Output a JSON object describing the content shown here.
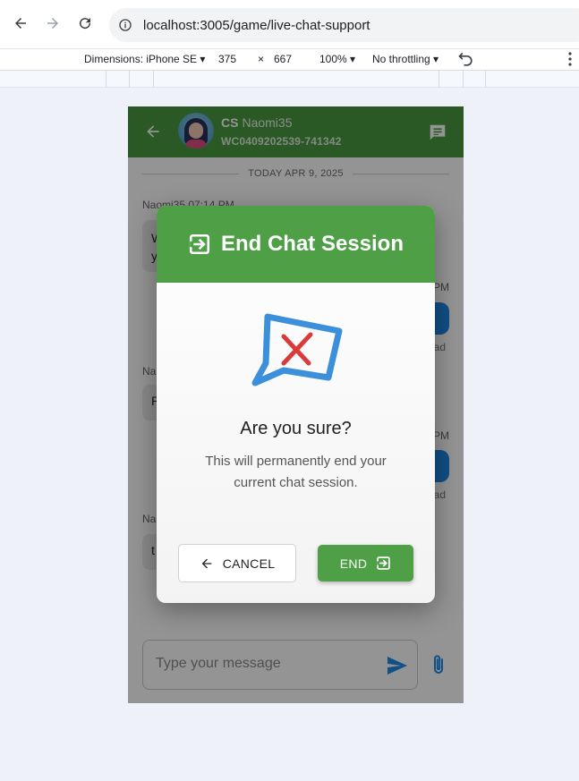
{
  "browser": {
    "url": "localhost:3005/game/live-chat-support"
  },
  "devtools": {
    "dimensions_label": "Dimensions: iPhone SE",
    "width": "375",
    "times": "×",
    "height": "667",
    "zoom": "100%",
    "throttling": "No throttling"
  },
  "chat": {
    "agent_prefix": "CS",
    "agent_name": "Naomi35",
    "ticket_id": "WC0409202539-741342",
    "date_divider": "TODAY APR 9, 2025",
    "messages": [
      {
        "meta": "Naomi35 07:14 PM",
        "partial": "W\ny"
      },
      {
        "time": "PM",
        "partial": "i",
        "read": "ad"
      },
      {
        "meta": "Na",
        "partial": "P"
      },
      {
        "time": "PM",
        "partial": "n",
        "read": "ad"
      },
      {
        "meta": "Na",
        "partial": "t"
      }
    ],
    "input_placeholder": "Type your message"
  },
  "dialog": {
    "title": "End Chat Session",
    "question": "Are you sure?",
    "description": "This will permanently end your current chat session.",
    "cancel_label": "CANCEL",
    "end_label": "END"
  },
  "colors": {
    "header_green": "#4a9a43",
    "end_button": "#4f9f47",
    "bubble_blue": "#1e88e5",
    "hero_icon_blue": "#3b8fdb",
    "hero_icon_x": "#d93b3b"
  },
  "icons": [
    "back-arrow-icon",
    "forward-arrow-icon",
    "reload-icon",
    "info-icon",
    "rotate-icon",
    "more-vert-icon",
    "chat-bubble-icon",
    "exit-icon",
    "chat-x-icon",
    "send-icon",
    "attach-icon"
  ]
}
